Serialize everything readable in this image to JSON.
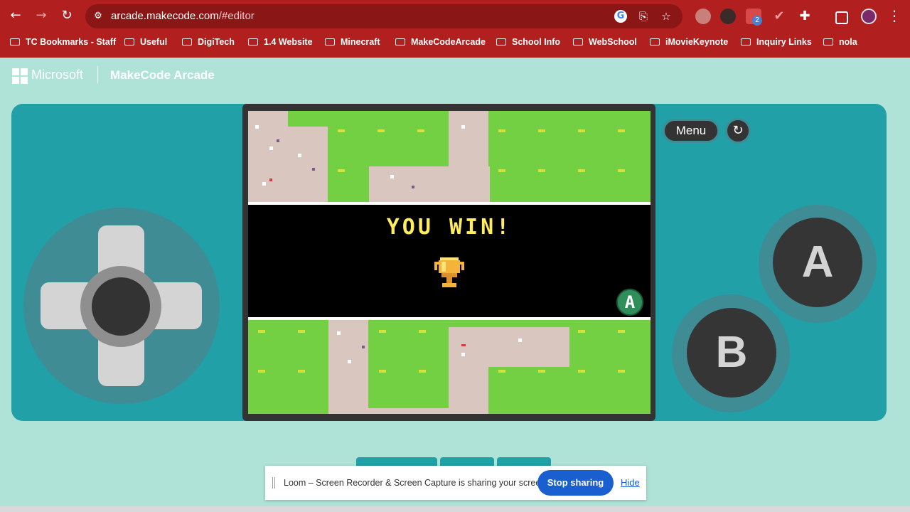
{
  "browser": {
    "url_host": "arcade.makecode.com",
    "url_path": "/#editor",
    "extension_badge": "2",
    "bookmarks": [
      {
        "label": "TC Bookmarks - Staff"
      },
      {
        "label": "Useful"
      },
      {
        "label": "DigiTech"
      },
      {
        "label": "1.4 Website"
      },
      {
        "label": "Minecraft"
      },
      {
        "label": "MakeCodeArcade"
      },
      {
        "label": "School Info"
      },
      {
        "label": "WebSchool"
      },
      {
        "label": "iMovieKeynote"
      },
      {
        "label": "Inquiry Links"
      },
      {
        "label": "nola"
      }
    ]
  },
  "header": {
    "brand": "Microsoft",
    "app_title": "MakeCode Arcade"
  },
  "simulator": {
    "menu_label": "Menu",
    "button_a": "A",
    "button_b": "B",
    "game": {
      "win_message": "YOU WIN!",
      "prompt_button": "A"
    }
  },
  "loom": {
    "message": "Loom – Screen Recorder & Screen Capture is sharing your screen.",
    "stop_label": "Stop sharing",
    "hide_label": "Hide"
  },
  "colors": {
    "chrome": "#b11f1f",
    "page_bg": "#afe3d7",
    "device": "#21a0a7",
    "win_text": "#ffed5e",
    "loom_accent": "#1a5fcf"
  }
}
